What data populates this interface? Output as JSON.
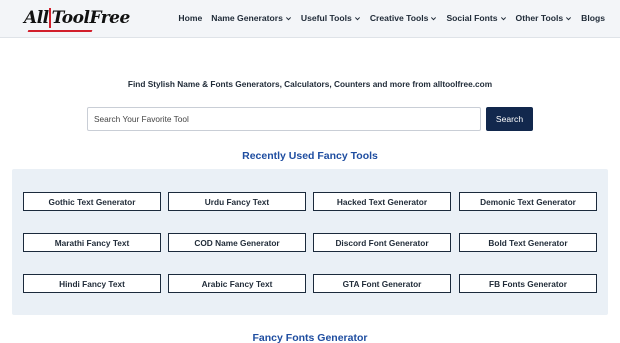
{
  "header": {
    "logo": {
      "part1": "All",
      "part2": "Tool",
      "part3": "Free"
    },
    "nav": [
      {
        "label": "Home",
        "dropdown": false
      },
      {
        "label": "Name Generators",
        "dropdown": true
      },
      {
        "label": "Useful Tools",
        "dropdown": true
      },
      {
        "label": "Creative Tools",
        "dropdown": true
      },
      {
        "label": "Social Fonts",
        "dropdown": true
      },
      {
        "label": "Other Tools",
        "dropdown": true
      },
      {
        "label": "Blogs",
        "dropdown": false
      }
    ]
  },
  "main": {
    "tagline": "Find Stylish Name & Fonts Generators, Calculators, Counters and more from alltoolfree.com",
    "search": {
      "placeholder": "Search Your Favorite Tool",
      "value": "",
      "button_label": "Search"
    },
    "recent_title": "Recently Used Fancy Tools",
    "tools": [
      "Gothic Text Generator",
      "Urdu Fancy Text",
      "Hacked Text Generator",
      "Demonic Text Generator",
      "Marathi Fancy Text",
      "COD Name Generator",
      "Discord Font Generator",
      "Bold Text Generator",
      "Hindi Fancy Text",
      "Arabic Fancy Text",
      "GTA Font Generator",
      "FB Fonts Generator"
    ],
    "fonts_title": "Fancy Fonts Generator"
  },
  "colors": {
    "accent": "#1e4da0",
    "button": "#12284d",
    "logo_red": "#d21f2b",
    "panel": "#eaf0f6",
    "header_bg": "#f3f5f8"
  },
  "icons": {
    "dropdown": "chevron-down-icon"
  }
}
